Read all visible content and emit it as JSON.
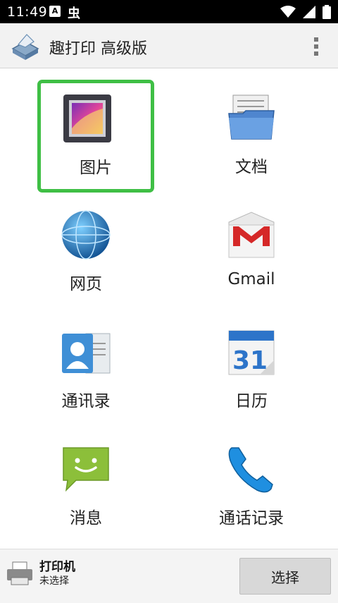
{
  "status_bar": {
    "time": "11:49",
    "notif_a": "A",
    "notif_bug": "虫",
    "icons": [
      "wifi-icon",
      "signal-icon",
      "battery-icon"
    ]
  },
  "app_bar": {
    "title": "趣打印 高级版"
  },
  "grid": [
    {
      "label": "图片",
      "icon": "photo-gallery-icon",
      "selected": true
    },
    {
      "label": "文档",
      "icon": "folder-documents-icon",
      "selected": false
    },
    {
      "label": "网页",
      "icon": "globe-icon",
      "selected": false
    },
    {
      "label": "Gmail",
      "icon": "gmail-icon",
      "selected": false
    },
    {
      "label": "通讯录",
      "icon": "contacts-icon",
      "selected": false
    },
    {
      "label": "日历",
      "icon": "calendar-icon",
      "selected": false
    },
    {
      "label": "消息",
      "icon": "message-icon",
      "selected": false
    },
    {
      "label": "通话记录",
      "icon": "phone-icon",
      "selected": false
    }
  ],
  "calendar_day": "31",
  "printer": {
    "title": "打印机",
    "status": "未选择",
    "button": "选择"
  },
  "colors": {
    "selection": "#3fbf45",
    "status_bar": "#000000",
    "action_bar": "#f2f2f2"
  }
}
